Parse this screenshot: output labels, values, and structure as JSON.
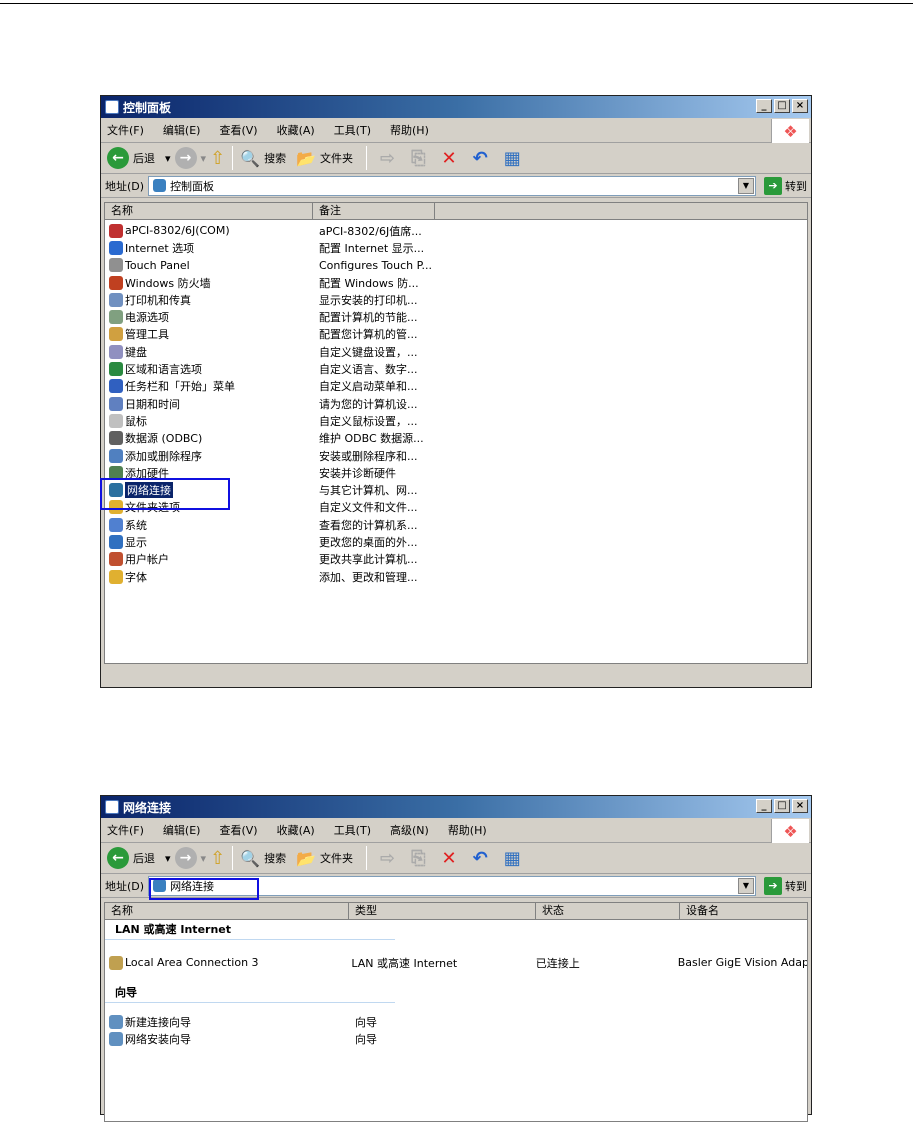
{
  "win1": {
    "title": "控制面板",
    "menu": [
      "文件(F)",
      "编辑(E)",
      "查看(V)",
      "收藏(A)",
      "工具(T)",
      "帮助(H)"
    ],
    "toolbar": {
      "back": "后退",
      "search": "搜索",
      "folders": "文件夹"
    },
    "address_label": "地址(D)",
    "address": "控制面板",
    "go": "转到",
    "columns": [
      "名称",
      "备注"
    ],
    "items": [
      {
        "name": "aPCI-8302/6J(COM)",
        "note": "aPCI-8302/6J值席...",
        "color": "#c03030"
      },
      {
        "name": "Internet 选项",
        "note": "配置 Internet 显示...",
        "color": "#2a6ad0"
      },
      {
        "name": "Touch Panel",
        "note": "Configures Touch P...",
        "color": "#909090"
      },
      {
        "name": "Windows 防火墙",
        "note": "配置 Windows 防...",
        "color": "#c04020"
      },
      {
        "name": "打印机和传真",
        "note": "显示安装的打印机...",
        "color": "#7090c0"
      },
      {
        "name": "电源选项",
        "note": "配置计算机的节能...",
        "color": "#80a080"
      },
      {
        "name": "管理工具",
        "note": "配置您计算机的管...",
        "color": "#d0a040"
      },
      {
        "name": "键盘",
        "note": "自定义键盘设置，...",
        "color": "#9090c0"
      },
      {
        "name": "区域和语言选项",
        "note": "自定义语言、数字...",
        "color": "#2a8a40"
      },
      {
        "name": "任务栏和「开始」菜单",
        "note": "自定义启动菜单和...",
        "color": "#3060c0"
      },
      {
        "name": "日期和时间",
        "note": "请为您的计算机设...",
        "color": "#6080c0"
      },
      {
        "name": "鼠标",
        "note": "自定义鼠标设置，...",
        "color": "#c0c0c0"
      },
      {
        "name": "数据源 (ODBC)",
        "note": "维护 ODBC 数据源...",
        "color": "#606060"
      },
      {
        "name": "添加或删除程序",
        "note": "安装或删除程序和...",
        "color": "#5080c0"
      },
      {
        "name": "添加硬件",
        "note": "安装并诊断硬件",
        "color": "#508050"
      },
      {
        "name": "网络连接",
        "note": "与其它计算机、网...",
        "color": "#2a70a0",
        "selected": true
      },
      {
        "name": "文件夹选项",
        "note": "自定义文件和文件...",
        "color": "#e0b030"
      },
      {
        "name": "系统",
        "note": "查看您的计算机系...",
        "color": "#5080d0"
      },
      {
        "name": "显示",
        "note": "更改您的桌面的外...",
        "color": "#3070c0"
      },
      {
        "name": "用户帐户",
        "note": "更改共享此计算机...",
        "color": "#c05030"
      },
      {
        "name": "字体",
        "note": "添加、更改和管理...",
        "color": "#e0b030"
      }
    ]
  },
  "win2": {
    "title": "网络连接",
    "menu": [
      "文件(F)",
      "编辑(E)",
      "查看(V)",
      "收藏(A)",
      "工具(T)",
      "高级(N)",
      "帮助(H)"
    ],
    "toolbar": {
      "back": "后退",
      "search": "搜索",
      "folders": "文件夹"
    },
    "address_label": "地址(D)",
    "address": "网络连接",
    "go": "转到",
    "columns": [
      "名称",
      "类型",
      "状态",
      "设备名"
    ],
    "groups": [
      {
        "title": "LAN 或高速 Internet",
        "items": [
          {
            "name": "Local Area Connection 3",
            "type": "LAN 或高速 Internet",
            "status": "已连接上",
            "device": "Basler GigE Vision Adap"
          }
        ]
      },
      {
        "title": "向导",
        "items": [
          {
            "name": "新建连接向导",
            "type": "向导",
            "status": "",
            "device": ""
          },
          {
            "name": "网络安装向导",
            "type": "向导",
            "status": "",
            "device": ""
          }
        ]
      }
    ]
  }
}
